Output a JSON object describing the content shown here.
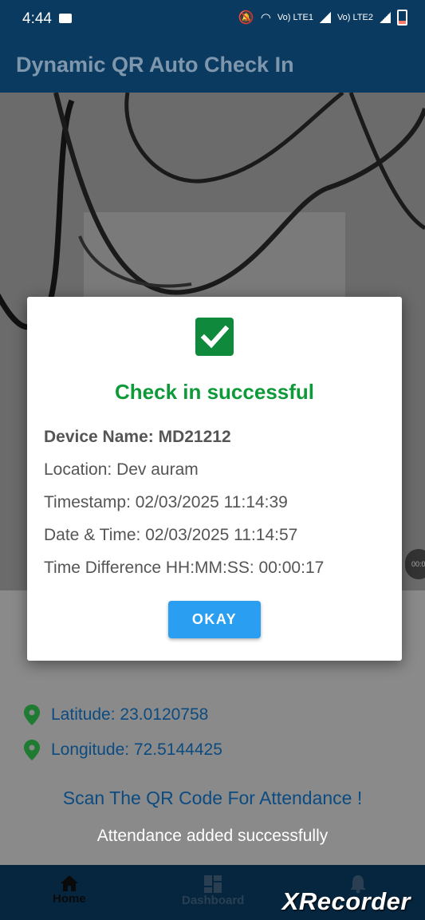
{
  "status_bar": {
    "time": "4:44",
    "sim1": "Vo) LTE1",
    "sim2": "Vo) LTE2"
  },
  "app_bar": {
    "title": "Dynamic QR Auto Check In"
  },
  "dialog": {
    "heading": "Check in successful",
    "device_name": "Device Name: MD21212",
    "location": "Location: Dev auram",
    "timestamp": "Timestamp: 02/03/2025 11:14:39",
    "date_time": "Date & Time: 02/03/2025 11:14:57",
    "time_difference": "Time Difference HH:MM:SS: 00:00:17",
    "okay_label": "OKAY"
  },
  "camera": {
    "side_chip": "00:0"
  },
  "location_info": {
    "latitude": "Latitude: 23.0120758",
    "longitude": "Longitude: 72.5144425"
  },
  "scan_prompt": "Scan The QR Code For Attendance !",
  "toast": "Attendance added successfully",
  "bottom_nav": {
    "items": [
      {
        "label": "Home",
        "icon": "home-icon"
      },
      {
        "label": "Dashboard",
        "icon": "dashboard-icon"
      },
      {
        "label": "",
        "icon": "bell-icon"
      }
    ]
  },
  "watermark": "XRecorder",
  "colors": {
    "primary": "#0b3a60",
    "success": "#0f9a3a",
    "button": "#2a9ef0"
  }
}
